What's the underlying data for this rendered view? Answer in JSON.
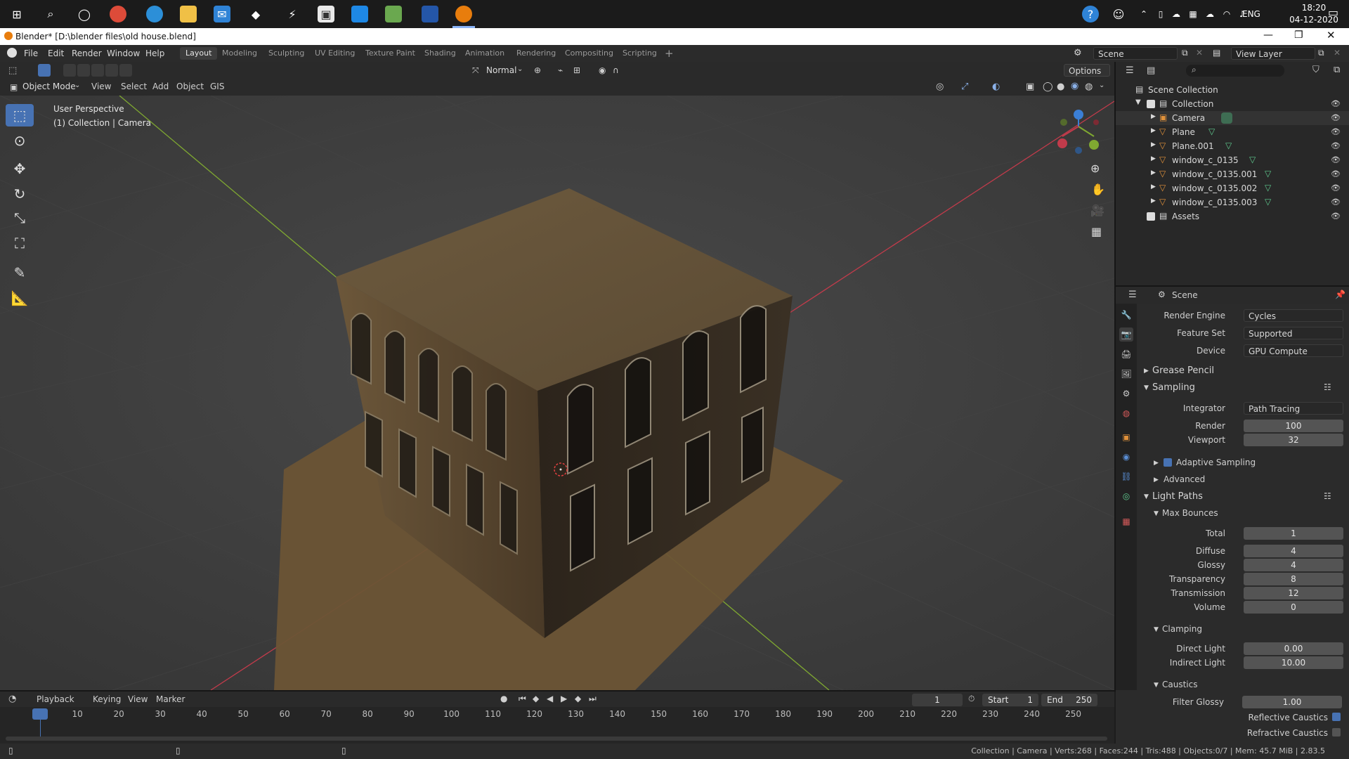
{
  "taskbar": {
    "icons": [
      "windows-start-icon",
      "search-icon",
      "cortana-icon",
      "chrome-icon",
      "edge-icon",
      "file-explorer-icon",
      "mail-icon",
      "dropbox-icon",
      "power-automate-icon",
      "store-icon",
      "kindle-icon",
      "stack-icon",
      "photos-icon",
      "blender-icon"
    ],
    "tray": {
      "lang": "ENG",
      "time": "18:20",
      "date": "04-12-2020"
    }
  },
  "window": {
    "title": "Blender* [D:\\blender files\\old house.blend]"
  },
  "menu": {
    "items": [
      "File",
      "Edit",
      "Render",
      "Window",
      "Help"
    ]
  },
  "workspaces": [
    "Layout",
    "Modeling",
    "Sculpting",
    "UV Editing",
    "Texture Paint",
    "Shading",
    "Animation",
    "Rendering",
    "Compositing",
    "Scripting"
  ],
  "topbar_right": {
    "scene_label": "Scene",
    "view_layer_label": "View Layer"
  },
  "viewport_header": {
    "orientation": "Normal",
    "options": "Options",
    "mode": "Object Mode",
    "menus": [
      "View",
      "Select",
      "Add",
      "Object",
      "GIS"
    ]
  },
  "viewport": {
    "perspective": "User Perspective",
    "context": "(1) Collection | Camera",
    "colors": {
      "x_axis": "#c23b4b",
      "y_axis": "#7fa831",
      "z_axis": "#3b7fd6"
    }
  },
  "outliner": {
    "root": "Scene Collection",
    "collection": "Collection",
    "objects": [
      "Camera",
      "Plane",
      "Plane.001",
      "window_c_0135",
      "window_c_0135.001",
      "window_c_0135.002",
      "window_c_0135.003"
    ],
    "assets": "Assets"
  },
  "properties": {
    "context": "Scene",
    "render_engine_label": "Render Engine",
    "render_engine": "Cycles",
    "feature_set_label": "Feature Set",
    "feature_set": "Supported",
    "device_label": "Device",
    "device": "GPU Compute",
    "grease_pencil": "Grease Pencil",
    "sampling": "Sampling",
    "integrator_label": "Integrator",
    "integrator": "Path Tracing",
    "render_label": "Render",
    "render_samples": "100",
    "viewport_label": "Viewport",
    "viewport_samples": "32",
    "adaptive_sampling": "Adaptive Sampling",
    "advanced": "Advanced",
    "light_paths": "Light Paths",
    "max_bounces": "Max Bounces",
    "bounces": [
      {
        "label": "Total",
        "value": "1"
      },
      {
        "label": "Diffuse",
        "value": "4"
      },
      {
        "label": "Glossy",
        "value": "4"
      },
      {
        "label": "Transparency",
        "value": "8"
      },
      {
        "label": "Transmission",
        "value": "12"
      },
      {
        "label": "Volume",
        "value": "0"
      }
    ],
    "clamping": "Clamping",
    "direct_light_label": "Direct Light",
    "direct_light": "0.00",
    "indirect_light_label": "Indirect Light",
    "indirect_light": "10.00",
    "caustics": "Caustics",
    "filter_glossy_label": "Filter Glossy",
    "filter_glossy": "1.00",
    "reflective_caustics": "Reflective Caustics",
    "refractive_caustics": "Refractive Caustics"
  },
  "timeline": {
    "menus": [
      "Playback",
      "Keying",
      "View",
      "Marker"
    ],
    "current_frame": "1",
    "start_label": "Start",
    "start": "1",
    "end_label": "End",
    "end": "250",
    "ticks": [
      "1",
      "10",
      "20",
      "30",
      "40",
      "50",
      "60",
      "70",
      "80",
      "90",
      "100",
      "110",
      "120",
      "130",
      "140",
      "150",
      "160",
      "170",
      "180",
      "190",
      "200",
      "210",
      "220",
      "230",
      "240",
      "250"
    ]
  },
  "status": {
    "text": "Collection | Camera | Verts:268 | Faces:244 | Tris:488 | Objects:0/7 | Mem: 45.7 MiB | 2.83.5"
  }
}
